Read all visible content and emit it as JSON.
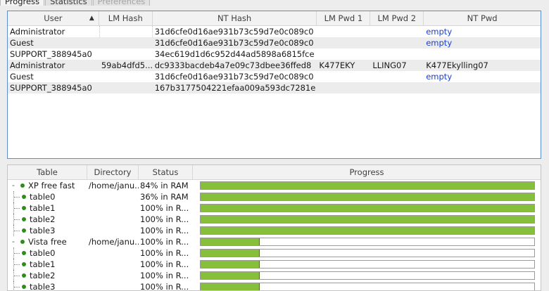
{
  "tabs": [
    {
      "label": "Progress",
      "state": "active"
    },
    {
      "label": "Statistics",
      "state": "normal"
    },
    {
      "label": "Preferences",
      "state": "disabled"
    }
  ],
  "hash_table": {
    "columns": [
      "User",
      "LM Hash",
      "NT Hash",
      "LM Pwd 1",
      "LM Pwd 2",
      "NT Pwd"
    ],
    "rows": [
      {
        "user": "Administrator",
        "lm_hash": "",
        "nt_hash": "31d6cfe0d16ae931b73c59d7e0c089c0",
        "lm_pwd1": "",
        "lm_pwd2": "",
        "nt_pwd": "empty"
      },
      {
        "user": "Guest",
        "lm_hash": "",
        "nt_hash": "31d6cfe0d16ae931b73c59d7e0c089c0",
        "lm_pwd1": "",
        "lm_pwd2": "",
        "nt_pwd": "empty"
      },
      {
        "user": "SUPPORT_388945a0",
        "lm_hash": "",
        "nt_hash": "34ec619d1d6c952d44ad5898a6815fce",
        "lm_pwd1": "",
        "lm_pwd2": "",
        "nt_pwd": ""
      },
      {
        "user": "Administrator",
        "lm_hash": "59ab4dfd5...",
        "nt_hash": "dc9333bacdeb4a7e09c73dbee36ffed8",
        "lm_pwd1": "K477EKY",
        "lm_pwd2": "LLING07",
        "nt_pwd": "K477Ekylling07"
      },
      {
        "user": "Guest",
        "lm_hash": "",
        "nt_hash": "31d6cfe0d16ae931b73c59d7e0c089c0",
        "lm_pwd1": "",
        "lm_pwd2": "",
        "nt_pwd": "empty"
      },
      {
        "user": "SUPPORT_388945a0",
        "lm_hash": "",
        "nt_hash": "167b3177504221efaa009a593dc7281e",
        "lm_pwd1": "",
        "lm_pwd2": "",
        "nt_pwd": ""
      }
    ]
  },
  "rainbow_tables": {
    "columns": [
      "Table",
      "Directory",
      "Status",
      "Progress"
    ],
    "rows": [
      {
        "level": 0,
        "expander": "-",
        "name": "XP free fast",
        "directory": "/home/janu...",
        "status": "84% in RAM",
        "progress": 1.0
      },
      {
        "level": 1,
        "expander": "",
        "name": "table0",
        "directory": "",
        "status": "36% in RAM",
        "progress": 1.0
      },
      {
        "level": 1,
        "expander": "",
        "name": "table1",
        "directory": "",
        "status": "100% in R...",
        "progress": 1.0
      },
      {
        "level": 1,
        "expander": "",
        "name": "table2",
        "directory": "",
        "status": "100% in R...",
        "progress": 1.0
      },
      {
        "level": 1,
        "expander": "",
        "name": "table3",
        "directory": "",
        "status": "100% in R...",
        "progress": 1.0
      },
      {
        "level": 0,
        "expander": "-",
        "name": "Vista free",
        "directory": "/home/janu...",
        "status": "100% in R...",
        "progress": 0.175
      },
      {
        "level": 1,
        "expander": "",
        "name": "table0",
        "directory": "",
        "status": "100% in R...",
        "progress": 0.175
      },
      {
        "level": 1,
        "expander": "",
        "name": "table1",
        "directory": "",
        "status": "100% in R...",
        "progress": 0.175
      },
      {
        "level": 1,
        "expander": "",
        "name": "table2",
        "directory": "",
        "status": "100% in R...",
        "progress": 0.175
      },
      {
        "level": 1,
        "expander": "",
        "name": "table3",
        "directory": "",
        "status": "100% in R...",
        "progress": 0.175
      }
    ]
  },
  "colors": {
    "progress_fill": "#86bf3a",
    "status_dot": "#2f8c1e",
    "empty_text": "#1a3fd6",
    "selection_border": "#5a8ecf"
  },
  "icons": {
    "sort": "sort-ascending-icon",
    "status": "green-dot-icon"
  }
}
